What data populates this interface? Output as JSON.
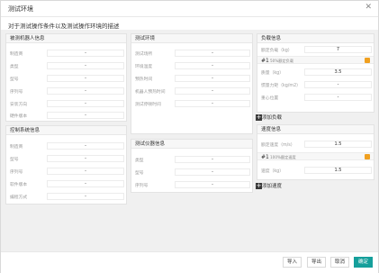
{
  "dialog": {
    "title": "测试环境",
    "subtitle": "对于测试操作条件以及测试操作环境的描述"
  },
  "robot": {
    "header": "被测机器人信息",
    "fields": [
      {
        "label": "制造商",
        "value": "-"
      },
      {
        "label": "类型",
        "value": "-"
      },
      {
        "label": "型号",
        "value": "-"
      },
      {
        "label": "序列号",
        "value": "-"
      },
      {
        "label": "安装方向",
        "value": "-"
      },
      {
        "label": "硬件版本",
        "value": "-"
      }
    ]
  },
  "control": {
    "header": "控制系统信息",
    "fields": [
      {
        "label": "制造商",
        "value": "-"
      },
      {
        "label": "型号",
        "value": "-"
      },
      {
        "label": "序列号",
        "value": "-"
      },
      {
        "label": "软件版本",
        "value": "-"
      },
      {
        "label": "编程方式",
        "value": "-"
      }
    ]
  },
  "env": {
    "header": "测试环境",
    "fields": [
      {
        "label": "测试场所",
        "value": "-"
      },
      {
        "label": "环境温度",
        "value": "-"
      },
      {
        "label": "预热时间",
        "value": "-"
      },
      {
        "label": "机器人预热时间",
        "value": "-"
      },
      {
        "label": "测试停顿时间",
        "value": "-"
      }
    ]
  },
  "instrument": {
    "header": "测试仪器信息",
    "fields": [
      {
        "label": "类型",
        "value": "-"
      },
      {
        "label": "型号",
        "value": "-"
      },
      {
        "label": "序列号",
        "value": "-"
      }
    ]
  },
  "load": {
    "header": "负载信息",
    "rated_label": "额定负载（kg）",
    "rated_value": "7",
    "item_num": "#1",
    "item_text": "50%额定负载",
    "fields": [
      {
        "label": "质量（kg）",
        "value": "3.5"
      },
      {
        "label": "惯量力矩（kg/m2）",
        "value": "-"
      },
      {
        "label": "重心位置",
        "value": "-"
      }
    ],
    "add_label": "添加负载"
  },
  "speed": {
    "header": "速度信息",
    "rated_label": "额定速度（m/s）",
    "rated_value": "1.5",
    "item_num": "#1",
    "item_text": "100%额定速度",
    "fields": [
      {
        "label": "速度（kg）",
        "value": "1.5"
      }
    ],
    "add_label": "添加速度"
  },
  "footer": {
    "import": "导入",
    "export": "导出",
    "cancel": "取消",
    "confirm": "确定"
  },
  "colors": {
    "primary": "#159f9b",
    "delete": "#f0a020"
  }
}
